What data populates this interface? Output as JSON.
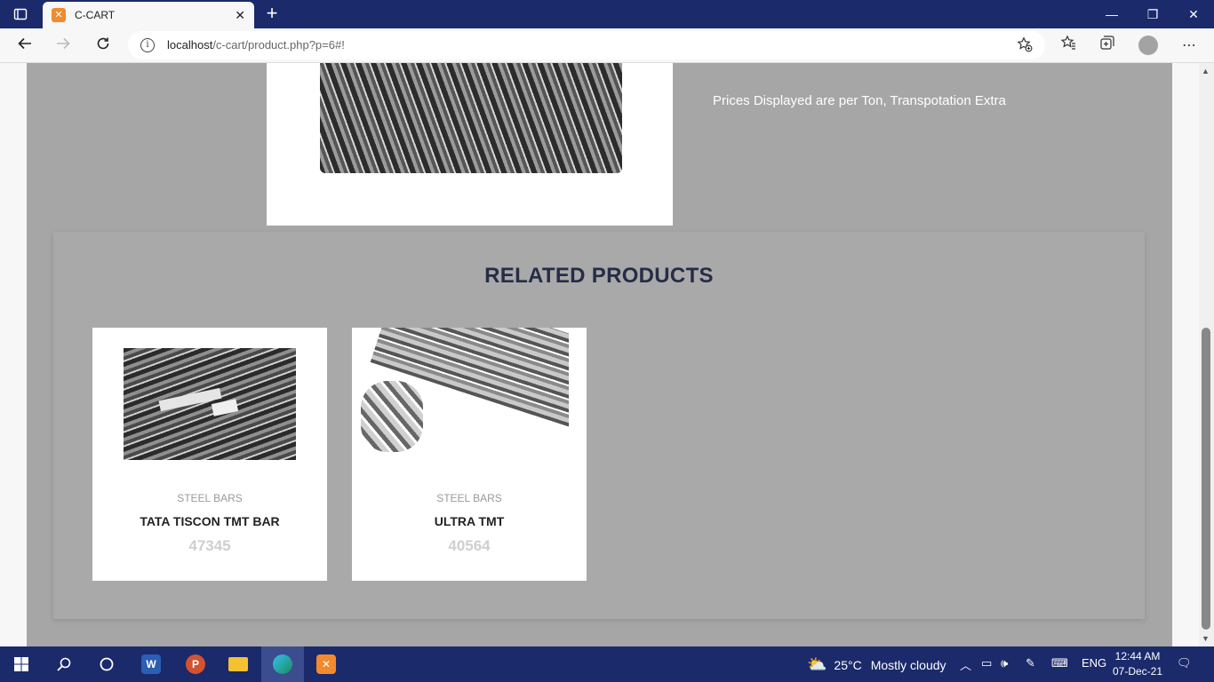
{
  "browser": {
    "tab_title": "C-CART",
    "tab_favicon": "xampp-icon",
    "url_host": "localhost",
    "url_path": "/c-cart/product.php?p=6#!",
    "new_tab_label": "+",
    "minimize": "—",
    "restore": "❐",
    "close": "✕"
  },
  "product": {
    "price_note": "Prices Displayed are per Ton, Transpotation Extra"
  },
  "related": {
    "title": "RELATED PRODUCTS",
    "items": [
      {
        "category": "STEEL BARS",
        "name": "TATA TISCON TMT BAR",
        "price": "47345"
      },
      {
        "category": "STEEL BARS",
        "name": "ULTRA TMT",
        "price": "40564"
      }
    ]
  },
  "taskbar": {
    "weather_temp": "25°C",
    "weather_text": "Mostly cloudy",
    "language": "ENG",
    "time": "12:44 AM",
    "date": "07-Dec-21",
    "apps": [
      "start-icon",
      "search-icon",
      "cortana-icon",
      "word-icon",
      "powerpoint-icon",
      "file-explorer-icon",
      "edge-icon",
      "xampp-icon"
    ]
  },
  "colors": {
    "titlebar": "#1b2a6b",
    "page_overlay": "#a6a6a6",
    "heading": "#252d47"
  }
}
